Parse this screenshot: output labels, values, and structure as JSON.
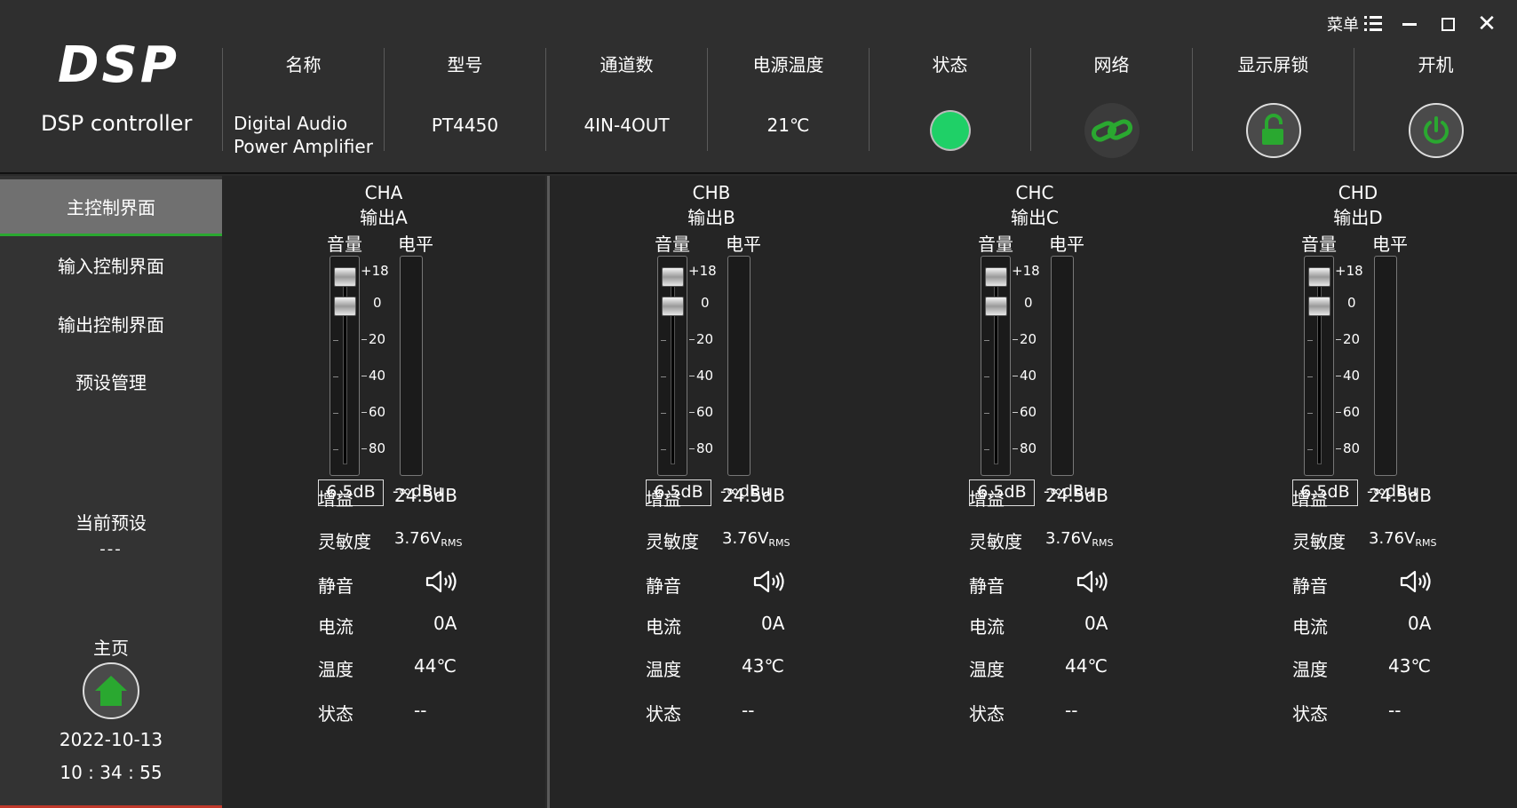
{
  "window": {
    "menu_label": "菜单",
    "min_icon": "minimize-icon",
    "max_icon": "maximize-icon",
    "close_icon": "close-icon",
    "close_glyph": "✕"
  },
  "brand": {
    "logo": "DSP",
    "subtitle": "DSP controller"
  },
  "device": {
    "columns": [
      {
        "label": "名称",
        "value": "Digital Audio\nPower Amplifier"
      },
      {
        "label": "型号",
        "value": "PT4450"
      },
      {
        "label": "通道数",
        "value": "4IN-4OUT"
      },
      {
        "label": "电源温度",
        "value": "21℃"
      },
      {
        "label": "状态",
        "icon": "status-led-icon"
      },
      {
        "label": "网络",
        "icon": "link-icon"
      },
      {
        "label": "显示屏锁",
        "icon": "unlock-icon"
      },
      {
        "label": "开机",
        "icon": "power-icon"
      }
    ],
    "name_line1": "Digital Audio",
    "name_line2": "Power Amplifier"
  },
  "colors": {
    "accent_green": "#1fd067",
    "icon_green": "#2aa830",
    "alert_red": "#c0392b"
  },
  "sidebar": {
    "items": [
      {
        "label": "主控制界面",
        "active": true
      },
      {
        "label": "输入控制界面",
        "active": false
      },
      {
        "label": "输出控制界面",
        "active": false
      },
      {
        "label": "预设管理",
        "active": false
      }
    ],
    "preset_label": "当前预设",
    "preset_value": "---",
    "home_label": "主页",
    "home_icon": "home-icon",
    "date": "2022-10-13",
    "time": "10 : 34 : 55"
  },
  "labels": {
    "volume": "音量",
    "level": "电平",
    "gain": "增益",
    "sensitivity": "灵敏度",
    "mute": "静音",
    "current": "电流",
    "temperature": "温度",
    "status": "状态"
  },
  "scale": [
    "+18",
    "0",
    "-20",
    "-40",
    "-60",
    "-80"
  ],
  "channels": [
    {
      "name": "CHA",
      "output": "输出A",
      "volume": "6.5dB",
      "level": "-∞dBu",
      "gain": "24.5dB",
      "sens_value": "3.76V",
      "sens_sub": "RMS",
      "current": "0A",
      "temperature": "44℃",
      "status": "--"
    },
    {
      "name": "CHB",
      "output": "输出B",
      "volume": "6.5dB",
      "level": "-∞dBu",
      "gain": "24.5dB",
      "sens_value": "3.76V",
      "sens_sub": "RMS",
      "current": "0A",
      "temperature": "43℃",
      "status": "--"
    },
    {
      "name": "CHC",
      "output": "输出C",
      "volume": "6.5dB",
      "level": "-∞dBu",
      "gain": "24.5dB",
      "sens_value": "3.76V",
      "sens_sub": "RMS",
      "current": "0A",
      "temperature": "44℃",
      "status": "--"
    },
    {
      "name": "CHD",
      "output": "输出D",
      "volume": "6.5dB",
      "level": "-∞dBu",
      "gain": "24.5dB",
      "sens_value": "3.76V",
      "sens_sub": "RMS",
      "current": "0A",
      "temperature": "43℃",
      "status": "--"
    }
  ]
}
